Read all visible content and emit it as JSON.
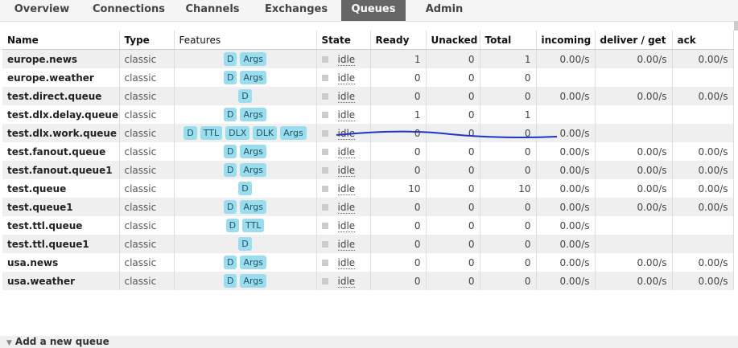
{
  "nav": {
    "tabs": [
      {
        "label": "Overview",
        "active": false
      },
      {
        "label": "Connections",
        "active": false
      },
      {
        "label": "Channels",
        "active": false
      },
      {
        "label": "Exchanges",
        "active": false
      },
      {
        "label": "Queues",
        "active": true
      },
      {
        "label": "Admin",
        "active": false
      }
    ]
  },
  "table": {
    "headers": [
      "Name",
      "Type",
      "Features",
      "State",
      "Ready",
      "Unacked",
      "Total",
      "incoming",
      "deliver / get",
      "ack"
    ],
    "rows": [
      {
        "name": "europe.news",
        "type": "classic",
        "features": [
          "D",
          "Args"
        ],
        "state": "idle",
        "ready": "1",
        "unacked": "0",
        "total": "1",
        "incoming": "0.00/s",
        "deliver": "0.00/s",
        "ack": "0.00/s"
      },
      {
        "name": "europe.weather",
        "type": "classic",
        "features": [
          "D",
          "Args"
        ],
        "state": "idle",
        "ready": "0",
        "unacked": "0",
        "total": "0",
        "incoming": "",
        "deliver": "",
        "ack": ""
      },
      {
        "name": "test.direct.queue",
        "type": "classic",
        "features": [
          "D"
        ],
        "state": "idle",
        "ready": "0",
        "unacked": "0",
        "total": "0",
        "incoming": "0.00/s",
        "deliver": "0.00/s",
        "ack": "0.00/s"
      },
      {
        "name": "test.dlx.delay.queue",
        "type": "classic",
        "features": [
          "D",
          "Args"
        ],
        "state": "idle",
        "ready": "1",
        "unacked": "0",
        "total": "1",
        "incoming": "",
        "deliver": "",
        "ack": ""
      },
      {
        "name": "test.dlx.work.queue",
        "type": "classic",
        "features": [
          "D",
          "TTL",
          "DLX",
          "DLK",
          "Args"
        ],
        "state": "idle",
        "ready": "0",
        "unacked": "0",
        "total": "0",
        "incoming": "0.00/s",
        "deliver": "",
        "ack": ""
      },
      {
        "name": "test.fanout.queue",
        "type": "classic",
        "features": [
          "D",
          "Args"
        ],
        "state": "idle",
        "ready": "0",
        "unacked": "0",
        "total": "0",
        "incoming": "0.00/s",
        "deliver": "0.00/s",
        "ack": "0.00/s"
      },
      {
        "name": "test.fanout.queue1",
        "type": "classic",
        "features": [
          "D",
          "Args"
        ],
        "state": "idle",
        "ready": "0",
        "unacked": "0",
        "total": "0",
        "incoming": "0.00/s",
        "deliver": "0.00/s",
        "ack": "0.00/s"
      },
      {
        "name": "test.queue",
        "type": "classic",
        "features": [
          "D"
        ],
        "state": "idle",
        "ready": "10",
        "unacked": "0",
        "total": "10",
        "incoming": "0.00/s",
        "deliver": "0.00/s",
        "ack": "0.00/s"
      },
      {
        "name": "test.queue1",
        "type": "classic",
        "features": [
          "D",
          "Args"
        ],
        "state": "idle",
        "ready": "0",
        "unacked": "0",
        "total": "0",
        "incoming": "0.00/s",
        "deliver": "0.00/s",
        "ack": "0.00/s"
      },
      {
        "name": "test.ttl.queue",
        "type": "classic",
        "features": [
          "D",
          "TTL"
        ],
        "state": "idle",
        "ready": "0",
        "unacked": "0",
        "total": "0",
        "incoming": "0.00/s",
        "deliver": "",
        "ack": ""
      },
      {
        "name": "test.ttl.queue1",
        "type": "classic",
        "features": [
          "D"
        ],
        "state": "idle",
        "ready": "0",
        "unacked": "0",
        "total": "0",
        "incoming": "0.00/s",
        "deliver": "",
        "ack": ""
      },
      {
        "name": "usa.news",
        "type": "classic",
        "features": [
          "D",
          "Args"
        ],
        "state": "idle",
        "ready": "0",
        "unacked": "0",
        "total": "0",
        "incoming": "0.00/s",
        "deliver": "0.00/s",
        "ack": "0.00/s"
      },
      {
        "name": "usa.weather",
        "type": "classic",
        "features": [
          "D",
          "Args"
        ],
        "state": "idle",
        "ready": "0",
        "unacked": "0",
        "total": "0",
        "incoming": "0.00/s",
        "deliver": "0.00/s",
        "ack": "0.00/s"
      }
    ]
  },
  "add_queue": {
    "label": "Add a new queue"
  },
  "colors": {
    "badge": "#99ddee",
    "active_tab": "#666666",
    "annotation_line": "#2233cc"
  }
}
